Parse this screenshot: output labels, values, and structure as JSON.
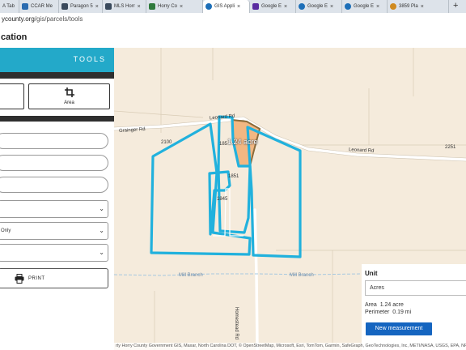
{
  "tabs": [
    {
      "label": "A Tab",
      "active": false
    },
    {
      "label": "CCAR Me",
      "active": false
    },
    {
      "label": "Paragon 5",
      "active": false
    },
    {
      "label": "MLS Horr",
      "active": false
    },
    {
      "label": "Horry Co",
      "active": false
    },
    {
      "label": "GIS Appli",
      "active": true
    },
    {
      "label": "Google E",
      "active": false
    },
    {
      "label": "Google E",
      "active": false
    },
    {
      "label": "Google E",
      "active": false
    },
    {
      "label": "3859 Pla",
      "active": false
    }
  ],
  "new_tab_symbol": "+",
  "address": {
    "url_prefix": "ycounty.org",
    "url_path": "/gis/parcels/tools"
  },
  "app": {
    "title": "cation"
  },
  "sidebar": {
    "tools_label": "TOOLS",
    "area_button_label": "Area",
    "select_2_value": "Only",
    "print_label": "PRINT"
  },
  "map": {
    "road_labels": {
      "grainger": "Grainger Rd",
      "leonard_top": "Leonard Rd",
      "leonard_right": "Leonard Rd",
      "homestead": "Homestead Rd",
      "mill_branch_1": "Mill Branch",
      "mill_branch_2": "Mill Branch"
    },
    "parcel_numbers": {
      "p2100": "2100",
      "p1851a": "185",
      "p1851": "1851",
      "p1845": "1845",
      "p2251": "2251"
    },
    "area_tag": "1.24 acre",
    "highlight_color": "#f0b98a",
    "outline_color": "#21b1dd"
  },
  "measurement": {
    "unit_label": "Unit",
    "unit_value": "Acres",
    "area_label": "Area",
    "area_value": "1.24 acre",
    "perimeter_label": "Perimeter",
    "perimeter_value": "0.19 mi",
    "new_button": "New measurement"
  },
  "attribution": "rty Horry County Government GIS, Maxar, North Carolina DOT, © OpenStreetMap, Microsoft, Esri, TomTom, Garmin, SafeGraph, GeoTechnologies, Inc, METI/NASA, USGS, EPA, NPS, US Census"
}
